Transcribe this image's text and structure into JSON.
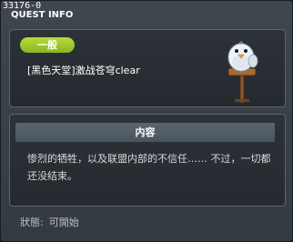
{
  "quest": {
    "id": "33176-0",
    "window_title": "QUEST INFO",
    "category": "一般",
    "name": "[黑色天堂]激战苍穹clear",
    "npc_icon": "snowman-npc-on-signpost-icon"
  },
  "detail": {
    "header": "内容",
    "text": "惨烈的牺牲，以及联盟内部的不信任…… 不过，一切都还没结束。"
  },
  "status": {
    "label": "狀態:",
    "value": "可開始"
  },
  "colors": {
    "badge_green": "#9cc82b",
    "panel_border": "#5b646d",
    "window_bg": "#3a4148"
  }
}
